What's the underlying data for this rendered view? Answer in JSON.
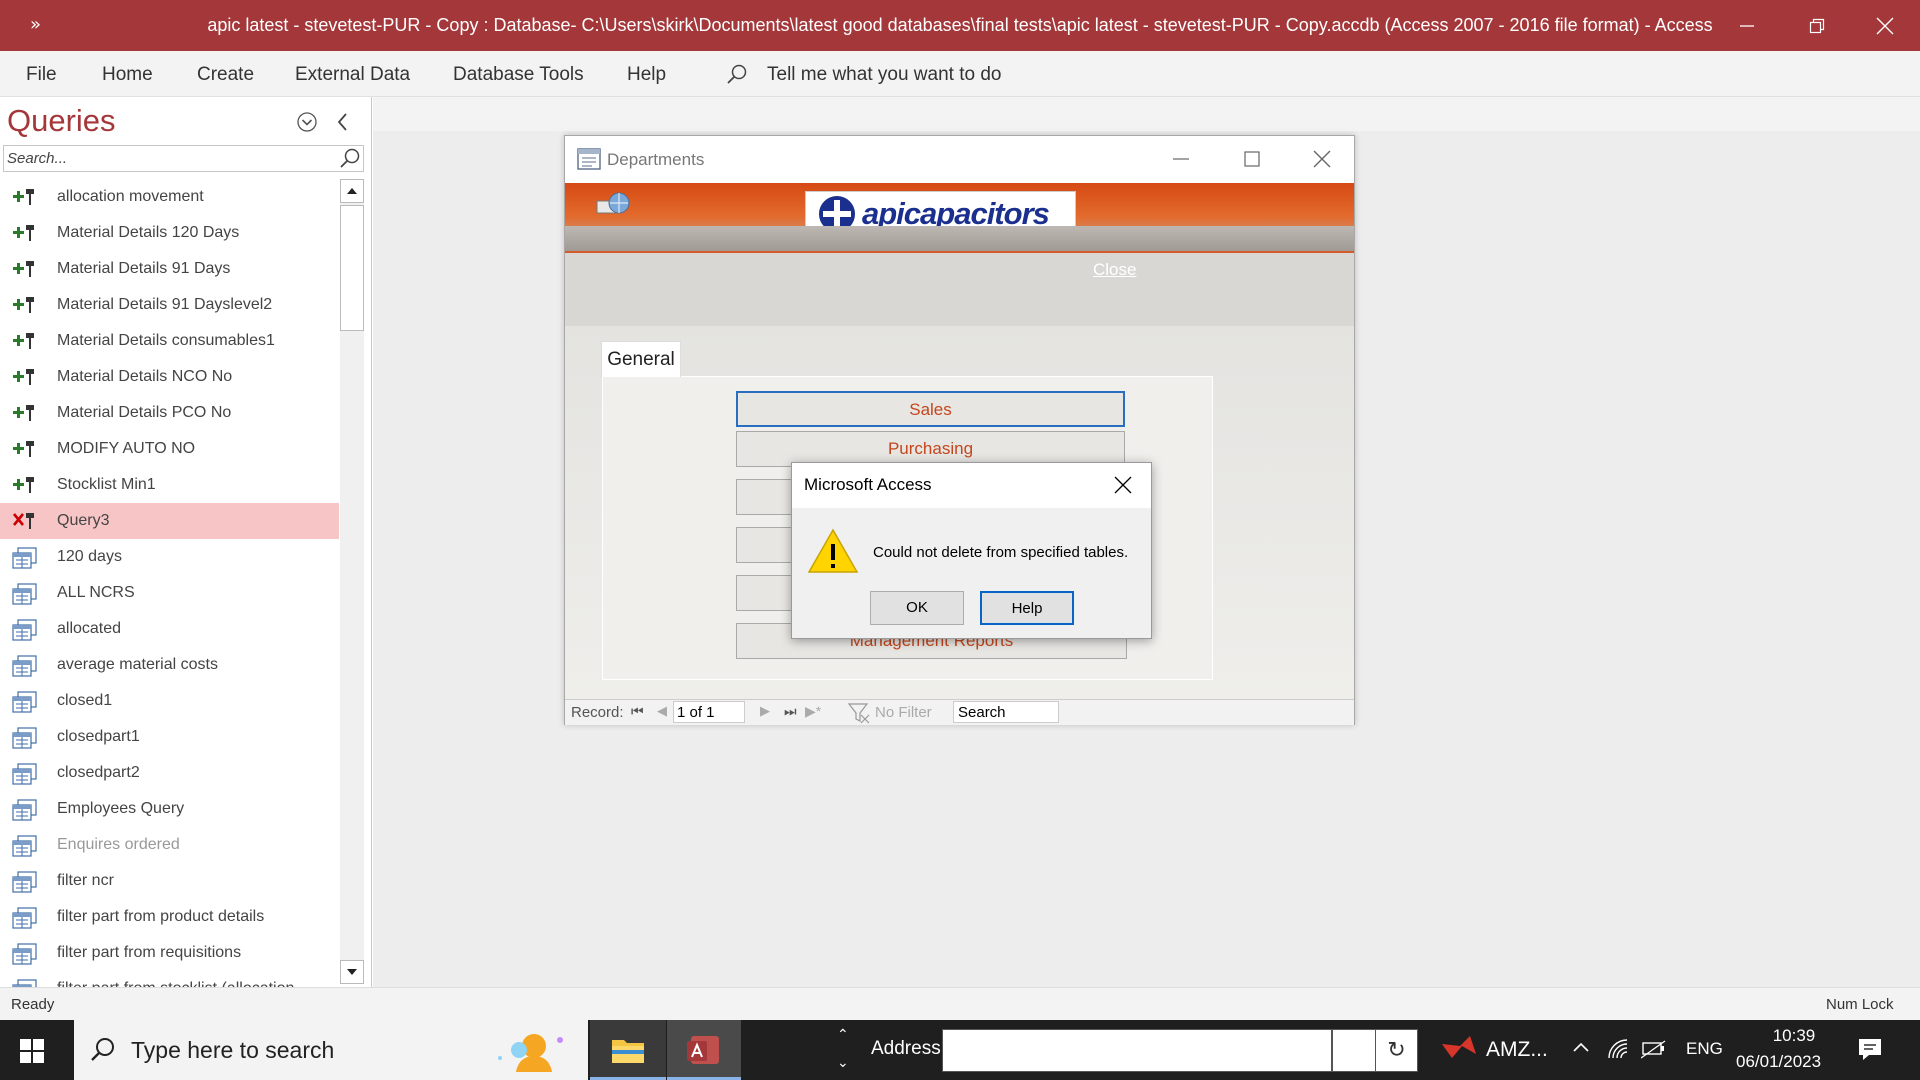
{
  "window": {
    "quick_access": "»",
    "title": "apic latest - stevetest-PUR - Copy : Database- C:\\Users\\skirk\\Documents\\latest good databases\\final tests\\apic latest - stevetest-PUR - Copy.accdb (Access 2007 - 2016 file format)  -  Access"
  },
  "ribbon": {
    "tabs": [
      "File",
      "Home",
      "Create",
      "External Data",
      "Database Tools",
      "Help"
    ],
    "tell_me": "Tell me what you want to do"
  },
  "nav": {
    "header": "Queries",
    "search_placeholder": "Search...",
    "items": [
      {
        "label": "allocation movement",
        "icon": "append-query-icon"
      },
      {
        "label": "Material Details 120 Days",
        "icon": "append-query-icon"
      },
      {
        "label": "Material Details 91 Days",
        "icon": "append-query-icon"
      },
      {
        "label": "Material Details 91 Dayslevel2",
        "icon": "append-query-icon"
      },
      {
        "label": "Material Details consumables1",
        "icon": "append-query-icon"
      },
      {
        "label": "Material Details NCO  No",
        "icon": "append-query-icon"
      },
      {
        "label": "Material Details PCO  No",
        "icon": "append-query-icon"
      },
      {
        "label": "MODIFY AUTO NO",
        "icon": "append-query-icon"
      },
      {
        "label": "Stocklist Min1",
        "icon": "append-query-icon"
      },
      {
        "label": "Query3",
        "icon": "delete-query-icon"
      },
      {
        "label": "120 days",
        "icon": "select-query-icon"
      },
      {
        "label": "ALL NCRS",
        "icon": "select-query-icon"
      },
      {
        "label": "allocated",
        "icon": "select-query-icon"
      },
      {
        "label": "average material  costs",
        "icon": "select-query-icon"
      },
      {
        "label": "closed1",
        "icon": "select-query-icon"
      },
      {
        "label": "closedpart1",
        "icon": "select-query-icon"
      },
      {
        "label": "closedpart2",
        "icon": "select-query-icon"
      },
      {
        "label": "Employees Query",
        "icon": "select-query-icon"
      },
      {
        "label": "Enquires ordered",
        "icon": "select-query-icon"
      },
      {
        "label": "filter ncr",
        "icon": "select-query-icon"
      },
      {
        "label": "filter part from product details",
        "icon": "select-query-icon"
      },
      {
        "label": "filter part from requisitions",
        "icon": "select-query-icon"
      },
      {
        "label": "filter part from stocklist (allocation",
        "icon": "select-query-icon"
      }
    ]
  },
  "form": {
    "title": "Departments",
    "logo_text_bold": "api",
    "logo_text": "capacitors",
    "close_link": "Close",
    "tab": "General",
    "buttons": [
      "Sales",
      "Purchasing",
      "",
      "",
      "",
      "Management Reports"
    ],
    "record_label": "Record:",
    "record_value": "1 of 1",
    "filter_label": "No Filter",
    "search_label": "Search"
  },
  "dialog": {
    "title": "Microsoft Access",
    "message": "Could not delete from specified tables.",
    "ok": "OK",
    "help": "Help"
  },
  "status": {
    "left": "Ready",
    "right": "Num Lock"
  },
  "taskbar": {
    "search_placeholder": "Type here to search",
    "address_label": "Address",
    "tray_app": "AMZ...",
    "language": "ENG",
    "time": "10:39",
    "date": "06/01/2023"
  }
}
